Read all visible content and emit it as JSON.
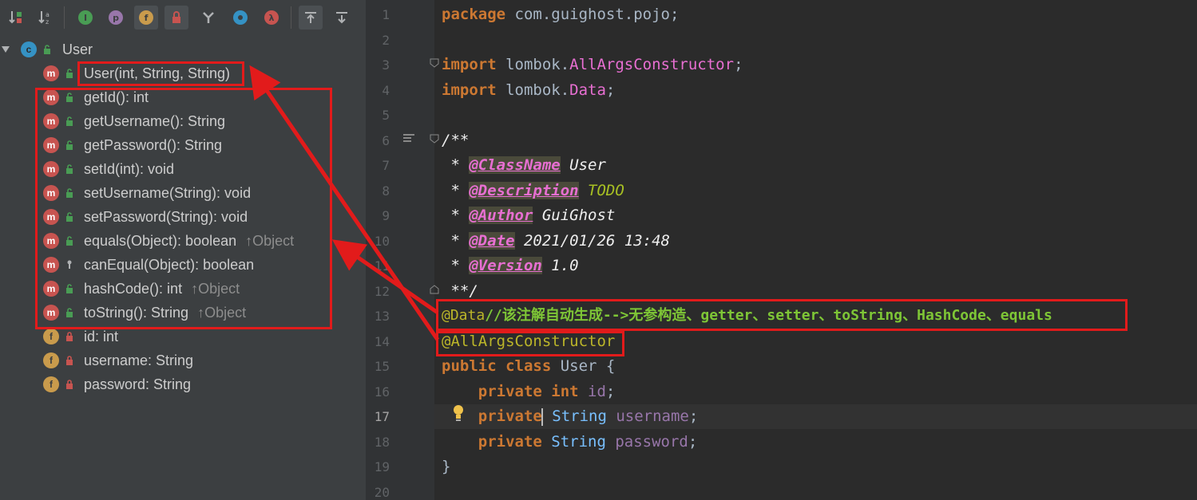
{
  "structure": {
    "toolbar": [
      {
        "name": "sort-by-visibility-icon"
      },
      {
        "name": "sort-alphabetically-icon"
      },
      {
        "name": "show-inherited-icon",
        "glyph": "I"
      },
      {
        "name": "show-properties-icon",
        "glyph": "p"
      },
      {
        "name": "show-fields-icon",
        "glyph": "f"
      },
      {
        "name": "show-non-public-icon"
      },
      {
        "name": "show-lambdas-icon"
      },
      {
        "name": "show-anonymous-icon"
      },
      {
        "name": "show-lambda-icon",
        "glyph": "λ"
      },
      {
        "name": "autoscroll-to-source-icon"
      },
      {
        "name": "autoscroll-from-source-icon"
      }
    ],
    "class_node": {
      "icon": "c",
      "label": "User"
    },
    "members": [
      {
        "kind": "m",
        "label": "User(int, String, String)",
        "inherited": ""
      },
      {
        "kind": "m",
        "label": "getId(): int",
        "inherited": ""
      },
      {
        "kind": "m",
        "label": "getUsername(): String",
        "inherited": ""
      },
      {
        "kind": "m",
        "label": "getPassword(): String",
        "inherited": ""
      },
      {
        "kind": "m",
        "label": "setId(int): void",
        "inherited": ""
      },
      {
        "kind": "m",
        "label": "setUsername(String): void",
        "inherited": ""
      },
      {
        "kind": "m",
        "label": "setPassword(String): void",
        "inherited": ""
      },
      {
        "kind": "m",
        "label": "equals(Object): boolean",
        "inherited": "↑Object"
      },
      {
        "kind": "m",
        "label": "canEqual(Object): boolean",
        "inherited": ""
      },
      {
        "kind": "m",
        "label": "hashCode(): int",
        "inherited": "↑Object"
      },
      {
        "kind": "m",
        "label": "toString(): String",
        "inherited": "↑Object"
      },
      {
        "kind": "f",
        "label": "id: int",
        "inherited": ""
      },
      {
        "kind": "f",
        "label": "username: String",
        "inherited": ""
      },
      {
        "kind": "f",
        "label": "password: String",
        "inherited": ""
      }
    ]
  },
  "editor": {
    "line_numbers": [
      "1",
      "2",
      "3",
      "4",
      "5",
      "6",
      "7",
      "8",
      "9",
      "10",
      "11",
      "12",
      "13",
      "14",
      "15",
      "16",
      "17",
      "18",
      "19",
      "20"
    ],
    "current_line": "17",
    "code": {
      "l1_kw": "package",
      "l1_rest": " com.guighost.pojo;",
      "l3_kw": "import",
      "l3_pkg": " lombok.",
      "l3_cls": "AllArgsConstructor",
      "l3_end": ";",
      "l4_kw": "import",
      "l4_pkg": " lombok.",
      "l4_cls": "Data",
      "l4_end": ";",
      "l6": "/**",
      "l7_star": " * ",
      "l7_tag": "@ClassName",
      "l7_val": " User",
      "l8_star": " * ",
      "l8_tag": "@Description",
      "l8_val": " TODO",
      "l9_star": " * ",
      "l9_tag": "@Author",
      "l9_val": " GuiGhost",
      "l10_star": " * ",
      "l10_tag": "@Date",
      "l10_val": " 2021/01/26 13:48",
      "l11_star": " * ",
      "l11_tag": "@Version",
      "l11_val": " 1.0",
      "l12": " **/",
      "l13_ann": "@Data",
      "l13_cmt": "//该注解自动生成-->无参构造、getter、setter、toString、HashCode、equals",
      "l14_ann": "@AllArgsConstructor",
      "l15_kw": "public class",
      "l15_rest": " User {",
      "l16_kw": "    private int",
      "l16_field": " id",
      "l16_end": ";",
      "l17_kw": "    private",
      "l17_type": " String",
      "l17_field": " username",
      "l17_end": ";",
      "l18_kw": "    private",
      "l18_type": " String",
      "l18_field": " password",
      "l18_end": ";",
      "l19": "}"
    }
  },
  "colors": {
    "annotation_box": "#e21b1b",
    "panel_bg": "#3c3f41",
    "editor_bg": "#2b2b2b"
  }
}
